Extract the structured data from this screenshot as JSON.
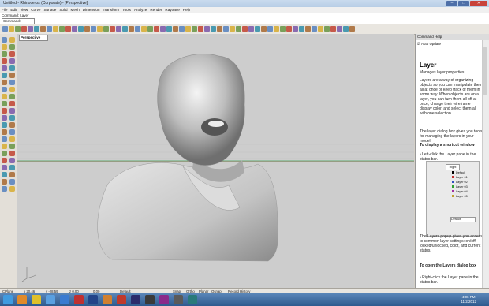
{
  "window": {
    "title": "Untitled - Rhinoceros (Corporate) - [Perspective]"
  },
  "menu": [
    "File",
    "Edit",
    "View",
    "Curve",
    "Surface",
    "Solid",
    "Mesh",
    "Dimension",
    "Transform",
    "Tools",
    "Analyze",
    "Render",
    "Raytrace",
    "Help"
  ],
  "command": {
    "history_label": "Command: Layer",
    "prompt": "Command:"
  },
  "viewport": {
    "tab": "Perspective"
  },
  "command_help": {
    "header": "Command Help",
    "auto_update": "Auto Update",
    "heading": "Layer",
    "p1": "Manages layer properties.",
    "p2": "Layers are a way of organizing objects so you can manipulate them all at once or keep track of them in some way. When objects are on a layer, you can turn them all off at once, change their wireframe display color, and select them all with one selection.",
    "p3": "The layer dialog box gives you tools for managing the layers in your model.",
    "sub1": "To display a shortcut window",
    "step1": "Left-click the Layer pane in the status bar.",
    "popup_title": "Right",
    "layers": [
      "Default",
      "Layer 01",
      "Layer 02",
      "Layer 03",
      "Layer 04",
      "Layer 05"
    ],
    "popup_footer": "Default",
    "p4": "The Layers popup gives you access to common layer settings: on/off, locked/unlocked, color, and current status.",
    "sub2": "To open the Layers dialog box",
    "step2": "Right-click the Layer pane in the status bar."
  },
  "status": {
    "cplane": "CPlane",
    "x": "x 20.46",
    "y": "y -28.59",
    "z": "z 0.00",
    "units": "0.00",
    "layer": "Default",
    "snap": "Snap",
    "ortho": "Ortho",
    "planar": "Planar",
    "osnap": "Osnap",
    "record": "Record History"
  },
  "taskbar": {
    "time": "4:06 PM",
    "date": "11/2/2012"
  },
  "colors": {
    "taskbar": "#2f5a8e",
    "viewport": "#cdcdcd"
  }
}
